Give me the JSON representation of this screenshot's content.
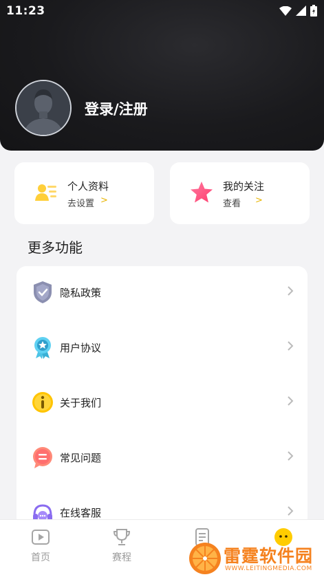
{
  "status_bar": {
    "time": "11:23",
    "icons": [
      "wifi-icon",
      "signal-icon",
      "battery-icon"
    ]
  },
  "profile": {
    "login_label": "登录/注册"
  },
  "cards": [
    {
      "title": "个人资料",
      "subtitle": "去设置",
      "icon": "id-card-icon"
    },
    {
      "title": "我的关注",
      "subtitle": "查看",
      "icon": "star-icon"
    }
  ],
  "section": {
    "title": "更多功能"
  },
  "menu": {
    "items": [
      {
        "label": "隐私政策",
        "icon": "shield-icon"
      },
      {
        "label": "用户协议",
        "icon": "badge-icon"
      },
      {
        "label": "关于我们",
        "icon": "info-icon"
      },
      {
        "label": "常见问题",
        "icon": "chat-icon"
      },
      {
        "label": "在线客服",
        "icon": "headset-icon"
      }
    ]
  },
  "tabbar": {
    "tabs": [
      {
        "label": "首页",
        "icon": "play-icon"
      },
      {
        "label": "赛程",
        "icon": "trophy-icon"
      },
      {
        "label": "",
        "icon": "document-icon"
      },
      {
        "label": "",
        "icon": "profile-face-icon"
      }
    ]
  },
  "watermark": {
    "text": "雷霆软件园",
    "url": "WWW.LEITINGMEDIA.COM"
  },
  "colors": {
    "header_bg": "#1a1a1d",
    "accent_yellow": "#ffcc00",
    "star_pink": "#ff5a8a",
    "watermark_orange": "#f5821f"
  }
}
